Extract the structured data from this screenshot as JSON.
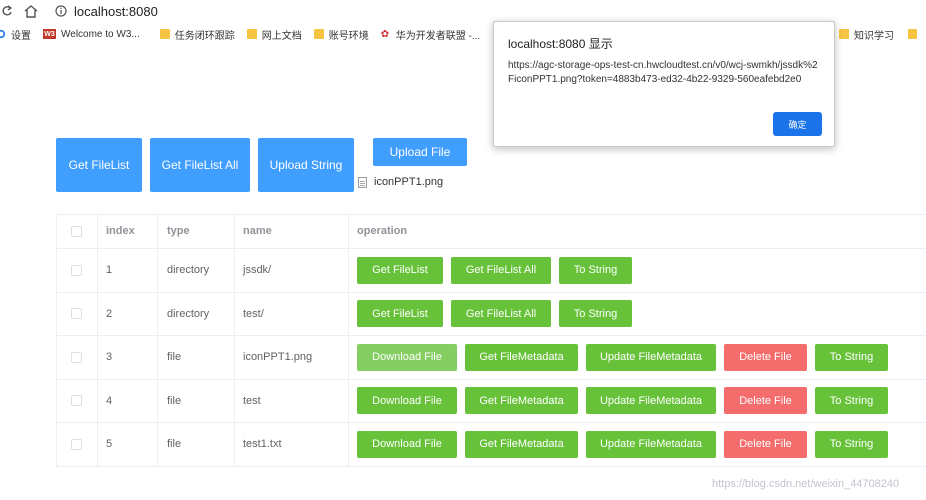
{
  "browser": {
    "url": "localhost:8080",
    "bookmarks": [
      {
        "icon": "gear-icon",
        "label": "设置"
      },
      {
        "icon": "w3-icon",
        "label": "Welcome to W3..."
      },
      {
        "icon": "folder-icon",
        "label": "任务闭环跟踪"
      },
      {
        "icon": "folder-icon",
        "label": "网上文档"
      },
      {
        "icon": "folder-icon",
        "label": "账号环境"
      },
      {
        "icon": "huawei-icon",
        "label": "华为开发者联盟 -..."
      },
      {
        "icon": "folder-icon",
        "label": "知识学习"
      }
    ]
  },
  "toolbar": {
    "get_filelist": "Get FileList",
    "get_filelist_all": "Get FileList All",
    "upload_string": "Upload String",
    "upload_file": "Upload File",
    "selected_file": "iconPPT1.png"
  },
  "table": {
    "headers": {
      "index": "index",
      "type": "type",
      "name": "name",
      "operation": "operation"
    },
    "rows": [
      {
        "index": "1",
        "type": "directory",
        "name": "jssdk/",
        "ops": [
          "Get FileList",
          "Get FileList All",
          "To String"
        ]
      },
      {
        "index": "2",
        "type": "directory",
        "name": "test/",
        "ops": [
          "Get FileList",
          "Get FileList All",
          "To String"
        ]
      },
      {
        "index": "3",
        "type": "file",
        "name": "iconPPT1.png",
        "ops": [
          "Download File",
          "Get FileMetadata",
          "Update FileMetadata",
          "Delete File",
          "To String"
        ]
      },
      {
        "index": "4",
        "type": "file",
        "name": "test",
        "ops": [
          "Download File",
          "Get FileMetadata",
          "Update FileMetadata",
          "Delete File",
          "To String"
        ]
      },
      {
        "index": "5",
        "type": "file",
        "name": "test1.txt",
        "ops": [
          "Download File",
          "Get FileMetadata",
          "Update FileMetadata",
          "Delete File",
          "To String"
        ]
      }
    ]
  },
  "dialog": {
    "title": "localhost:8080 显示",
    "message": "https://agc-storage-ops-test-cn.hwcloudtest.cn/v0/wcj-swmkh/jssdk%2FiconPPT1.png?token=4883b473-ed32-4b22-9329-560eafebd2e0",
    "ok_label": "确定"
  },
  "watermark": "https://blog.csdn.net/weixin_44708240",
  "colors": {
    "primary": "#409eff",
    "success": "#67c23a",
    "danger": "#f56c6c"
  }
}
